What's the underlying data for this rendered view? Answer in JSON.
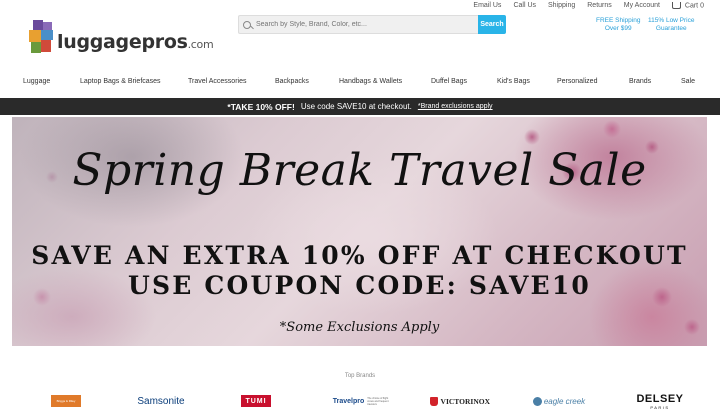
{
  "header": {
    "logo": {
      "main": "luggagepros",
      "suffix": ".com"
    },
    "utility_links": [
      "Email Us",
      "Call Us",
      "Shipping",
      "Returns",
      "My Account",
      "Cart"
    ],
    "cart_count": "0",
    "search": {
      "placeholder": "Search by Style, Brand, Color, etc...",
      "button": "Search"
    },
    "promos": [
      {
        "line1": "FREE Shipping",
        "line2": "Over $99"
      },
      {
        "line1": "115% Low Price",
        "line2": "Guarantee"
      }
    ]
  },
  "nav": [
    "Luggage",
    "Laptop Bags & Briefcases",
    "Travel Accessories",
    "Backpacks",
    "Handbags & Wallets",
    "Duffel Bags",
    "Kid's Bags",
    "Personalized",
    "Brands",
    "Sale"
  ],
  "notice": {
    "strong": "*TAKE 10% OFF!",
    "text": "Use code SAVE10 at checkout.",
    "link": "*Brand exclusions apply"
  },
  "hero": {
    "title": "Spring Break Travel Sale",
    "line1": "SAVE AN EXTRA 10% OFF AT CHECKOUT",
    "line2": "USE COUPON CODE: SAVE10",
    "note": "*Some Exclusions Apply"
  },
  "brands": {
    "title": "Top Brands",
    "items": [
      "Briggs & Riley",
      "Samsonite",
      "TUMI",
      "Travelpro",
      "VICTORINOX",
      "eagle creek",
      "DELSEY"
    ],
    "delsey_sub": "PARIS",
    "travelpro_tagline": "The choice of flight crews and frequent travelers"
  },
  "colors": {
    "accent": "#29b4e8",
    "notice_bg": "#2a2a2a"
  }
}
